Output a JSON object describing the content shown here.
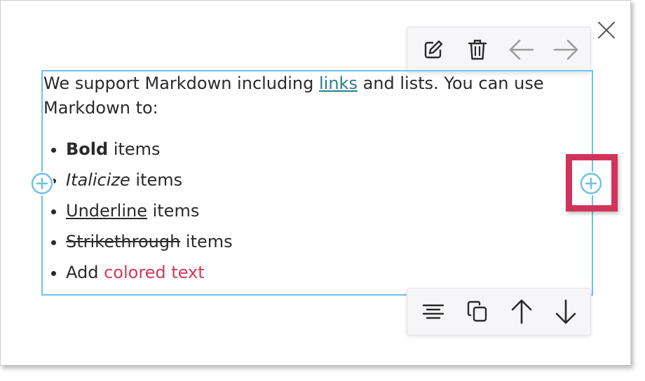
{
  "content": {
    "intro_1": "We support Markdown including ",
    "link": "links",
    "intro_2": " and lists. You can use Markdown to:",
    "items": [
      {
        "emph": "Bold",
        "rest": " items"
      },
      {
        "emph": "Italicize",
        "rest": " items"
      },
      {
        "emph": "Underline",
        "rest": " items"
      },
      {
        "emph": "Strikethrough",
        "rest": " items"
      },
      {
        "pre": "Add ",
        "colored": "colored text"
      }
    ]
  },
  "toolbar_top": [
    "edit-icon",
    "trash-icon",
    "arrow-left-icon",
    "arrow-right-icon"
  ],
  "toolbar_bottom": [
    "align-center-icon",
    "copy-icon",
    "arrow-up-icon",
    "arrow-down-icon"
  ],
  "colors": {
    "selection_border": "#6ec1e8",
    "highlight": "#d2335a",
    "link": "#2d7d8c",
    "colored_text": "#d13a5a"
  }
}
